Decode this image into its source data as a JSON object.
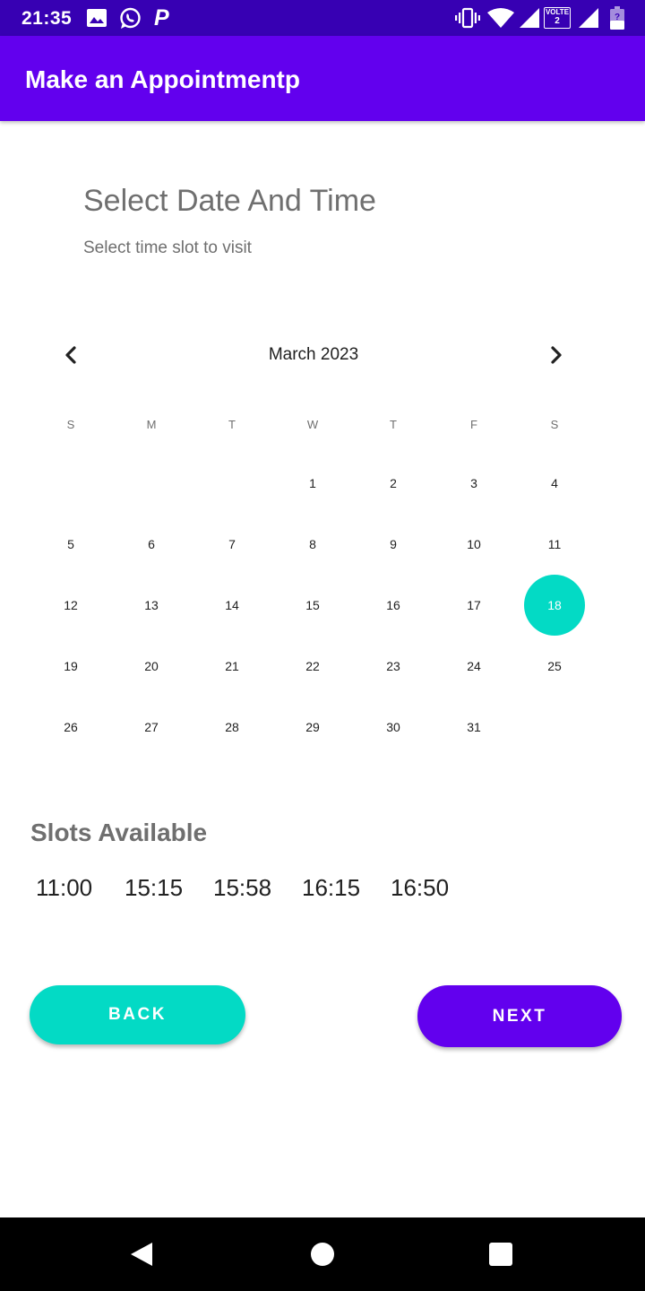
{
  "status_bar": {
    "time": "21:35",
    "left_icons": [
      "gallery-icon",
      "whatsapp-icon",
      "p-app-icon"
    ],
    "p_glyph": "P",
    "right_icons": [
      "vibrate-icon",
      "wifi-icon",
      "signal-icon",
      "volte-icon",
      "signal-icon",
      "battery-icon"
    ],
    "volte_label": "VOLTE",
    "volte_sub": "2"
  },
  "app_bar": {
    "title": "Make an Appointmentp",
    "color": "#6200ee"
  },
  "header": {
    "title": "Select Date And Time",
    "subtitle": "Select time slot to visit"
  },
  "calendar": {
    "month_label": "March 2023",
    "prev_icon": "chevron-left-icon",
    "next_icon": "chevron-right-icon",
    "weekdays": [
      "S",
      "M",
      "T",
      "W",
      "T",
      "F",
      "S"
    ],
    "first_weekday_index": 3,
    "days": [
      "1",
      "2",
      "3",
      "4",
      "5",
      "6",
      "7",
      "8",
      "9",
      "10",
      "11",
      "12",
      "13",
      "14",
      "15",
      "16",
      "17",
      "18",
      "19",
      "20",
      "21",
      "22",
      "23",
      "24",
      "25",
      "26",
      "27",
      "28",
      "29",
      "30",
      "31"
    ],
    "selected_day": "18",
    "selected_color": "#03dac5"
  },
  "slots": {
    "title": "Slots Available",
    "times": [
      "11:00",
      "15:15",
      "15:58",
      "16:15",
      "16:50"
    ]
  },
  "buttons": {
    "back_label": "BACK",
    "back_color": "#03dac5",
    "next_label": "NEXT",
    "next_color": "#6200ee"
  },
  "nav_bar": {
    "icons": [
      "nav-back-icon",
      "nav-home-icon",
      "nav-recents-icon"
    ]
  }
}
